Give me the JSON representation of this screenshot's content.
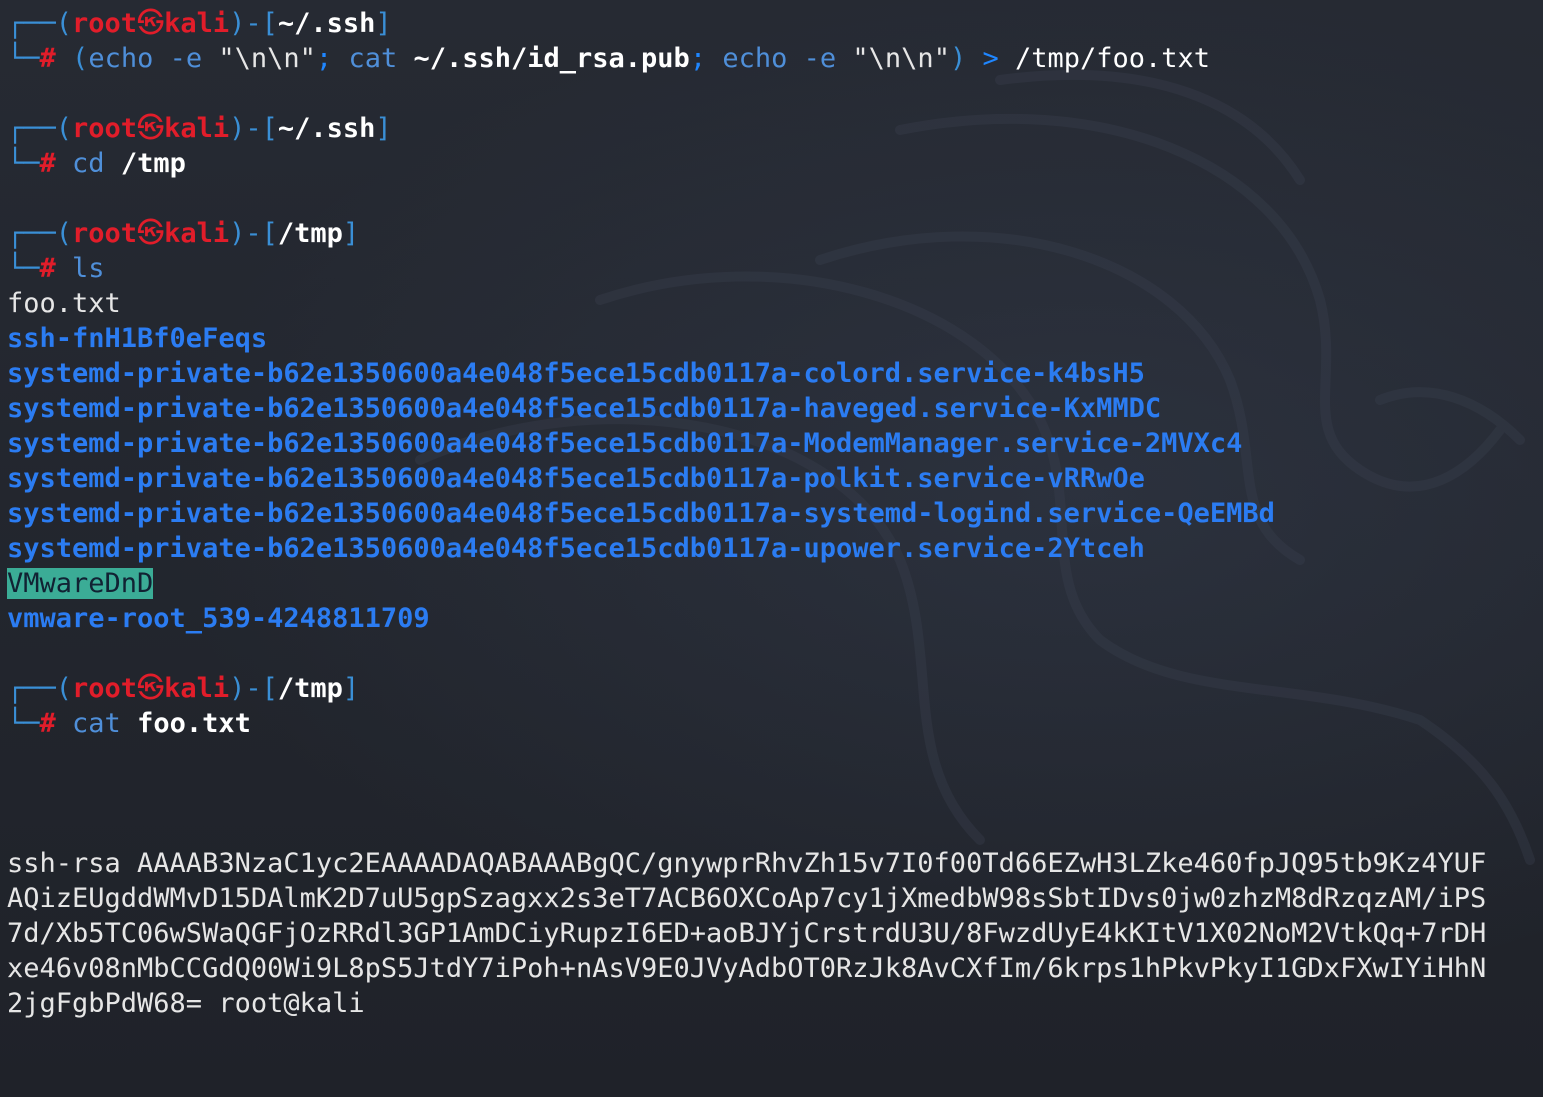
{
  "prompt_user": "root",
  "prompt_host": "kali",
  "prompt_skull": "㉿",
  "prompts": [
    {
      "dir": "~/.ssh",
      "command": {
        "p1": "(",
        "echo1": "echo",
        "flag1": " -e",
        "str1": " \"\\n\\n\"",
        "semi1": ";",
        "cat": " cat",
        "catarg": " ~/.ssh/id_rsa.pub",
        "semi2": ";",
        "echo2": " echo",
        "flag2": " -e",
        "str2": " \"\\n\\n\"",
        "p2": ")",
        "redir": " >",
        "dest": " /tmp/foo.txt"
      }
    },
    {
      "dir": "~/.ssh",
      "cmd": "cd",
      "arg": "/tmp"
    },
    {
      "dir": "/tmp",
      "cmd": "ls",
      "arg": ""
    },
    {
      "dir": "/tmp",
      "cmd": "cat",
      "arg": "foo.txt"
    }
  ],
  "ls_output": [
    {
      "name": "foo.txt",
      "kind": "file"
    },
    {
      "name": "ssh-fnH1Bf0eFeqs",
      "kind": "dir"
    },
    {
      "name": "systemd-private-b62e1350600a4e048f5ece15cdb0117a-colord.service-k4bsH5",
      "kind": "dir"
    },
    {
      "name": "systemd-private-b62e1350600a4e048f5ece15cdb0117a-haveged.service-KxMMDC",
      "kind": "dir"
    },
    {
      "name": "systemd-private-b62e1350600a4e048f5ece15cdb0117a-ModemManager.service-2MVXc4",
      "kind": "dir"
    },
    {
      "name": "systemd-private-b62e1350600a4e048f5ece15cdb0117a-polkit.service-vRRwOe",
      "kind": "dir"
    },
    {
      "name": "systemd-private-b62e1350600a4e048f5ece15cdb0117a-systemd-logind.service-QeEMBd",
      "kind": "dir"
    },
    {
      "name": "systemd-private-b62e1350600a4e048f5ece15cdb0117a-upower.service-2Ytceh",
      "kind": "dir"
    },
    {
      "name": "VMwareDnD",
      "kind": "sticky"
    },
    {
      "name": "vmware-root_539-4248811709",
      "kind": "dir"
    }
  ],
  "cat_output": [
    "ssh-rsa AAAAB3NzaC1yc2EAAAADAQABAAABgQC/gnywprRhvZh15v7I0f00Td66EZwH3LZke460fpJQ95tb9Kz4YUF",
    "AQizEUgddWMvD15DAlmK2D7uU5gpSzagxx2s3eT7ACB6OXCoAp7cy1jXmedbW98sSbtIDvs0jw0zhzM8dRzqzAM/iPS",
    "7d/Xb5TC06wSWaQGFjOzRRdl3GP1AmDCiyRupzI6ED+aoBJYjCrstrdU3U/8FwzdUyE4kKItV1X02NoM2VtkQq+7rDH",
    "xe46v08nMbCCGdQ00Wi9L8pS5JtdY7iPoh+nAsV9E0JVyAdbOT0RzJk8AvCXfIm/6krps1hPkvPkyI1GDxFXwIYiHhN",
    "2jgFgbPdW68= root@kali"
  ],
  "colors": {
    "background": "#23262f",
    "prompt_frame": "#3a8fd6",
    "prompt_user": "#e11d2a",
    "directory_listing": "#2b7cf2",
    "sticky_highlight": "#3bac96"
  }
}
